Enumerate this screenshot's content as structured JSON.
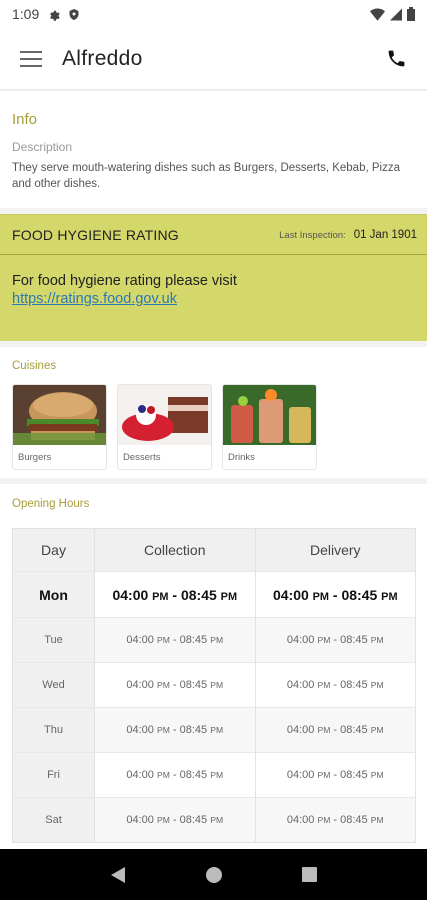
{
  "status_bar": {
    "time": "1:09"
  },
  "app_bar": {
    "title": "Alfreddo"
  },
  "info": {
    "heading": "Info",
    "description_label": "Description",
    "description_text": "They serve mouth-watering dishes such as Burgers, Desserts, Kebab, Pizza and other dishes."
  },
  "food_hygiene": {
    "title": "FOOD HYGIENE RATING",
    "last_inspection_label": "Last Inspection:",
    "last_inspection_date": "01 Jan 1901",
    "text": "For food hygiene rating please visit",
    "link": "https://ratings.food.gov.uk"
  },
  "cuisines": {
    "heading": "Cuisines",
    "items": [
      {
        "name": "Burgers",
        "icon": "burger-photo"
      },
      {
        "name": "Desserts",
        "icon": "dessert-photo"
      },
      {
        "name": "Drinks",
        "icon": "drinks-photo"
      }
    ]
  },
  "opening_hours": {
    "heading": "Opening Hours",
    "columns": [
      "Day",
      "Collection",
      "Delivery"
    ],
    "rows": [
      {
        "day": "Mon",
        "collection_start": "04:00",
        "collection_end": "08:45",
        "delivery_start": "04:00",
        "delivery_end": "08:45",
        "today": true
      },
      {
        "day": "Tue",
        "collection_start": "04:00",
        "collection_end": "08:45",
        "delivery_start": "04:00",
        "delivery_end": "08:45"
      },
      {
        "day": "Wed",
        "collection_start": "04:00",
        "collection_end": "08:45",
        "delivery_start": "04:00",
        "delivery_end": "08:45"
      },
      {
        "day": "Thu",
        "collection_start": "04:00",
        "collection_end": "08:45",
        "delivery_start": "04:00",
        "delivery_end": "08:45"
      },
      {
        "day": "Fri",
        "collection_start": "04:00",
        "collection_end": "08:45",
        "delivery_start": "04:00",
        "delivery_end": "08:45"
      },
      {
        "day": "Sat",
        "collection_start": "04:00",
        "collection_end": "08:45",
        "delivery_start": "04:00",
        "delivery_end": "08:45"
      }
    ],
    "pm": "PM",
    "separator": " - "
  },
  "colors": {
    "accent": "#a89c3a",
    "hygiene_bg": "#d4d769",
    "link": "#2a7ab8"
  }
}
